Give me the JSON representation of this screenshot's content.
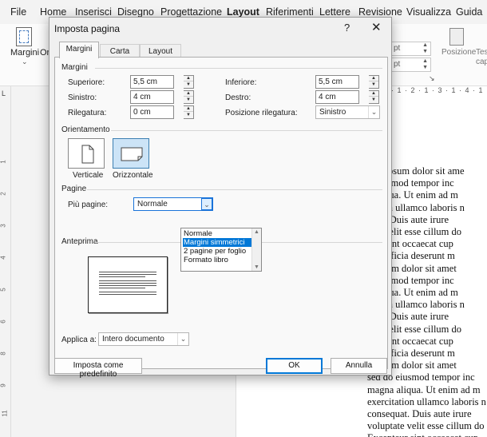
{
  "menubar": {
    "items": [
      "File",
      "Home",
      "Inserisci",
      "Disegno",
      "Progettazione",
      "Layout",
      "Riferimenti",
      "Lettere",
      "Revisione",
      "Visualizza",
      "Guida"
    ],
    "active": "Layout"
  },
  "ribbon": {
    "margini_label": "Margini",
    "or_label": "Or",
    "spin1": "pt",
    "spin2": "pt",
    "posizione_label": "Posizione",
    "tes_label": "Tes",
    "cap_label": "cap"
  },
  "ruler": {
    "top": "· 1 · 2 · 1 · 3 · 1 · 4 · 1 · 5",
    "corner": "L"
  },
  "document": {
    "lines": [
      "rem ipsum dolor sit ame",
      "o eiusmod tempor inc",
      "a aliqua. Ut enim ad m",
      "itation ullamco laboris n",
      "quat. Duis aute irure",
      "tate velit esse cillum do",
      "teur sint occaecat cup",
      " qui officia deserunt m",
      "n ipsum dolor sit amet",
      "o eiusmod tempor inc",
      "a aliqua. Ut enim ad m",
      "itation ullamco laboris n",
      "quat. Duis aute irure",
      "tate velit esse cillum do",
      "teur sint occaecat cup",
      " qui officia deserunt m",
      "n ipsum dolor sit amet",
      "sed do eiusmod tempor inc",
      "magna aliqua. Ut enim ad m",
      "exercitation ullamco laboris n",
      "consequat. Duis aute irure",
      "voluptate velit esse cillum do",
      "Excepteur sint occaecat cup"
    ]
  },
  "dialog": {
    "title": "Imposta pagina",
    "help": "?",
    "close": "✕",
    "tabs": [
      "Margini",
      "Carta",
      "Layout"
    ],
    "active_tab": "Margini",
    "margini": {
      "section": "Margini",
      "superiore_label": "Superiore:",
      "superiore_value": "5,5 cm",
      "inferiore_label": "Inferiore:",
      "inferiore_value": "5,5 cm",
      "sinistro_label": "Sinistro:",
      "sinistro_value": "4 cm",
      "destro_label": "Destro:",
      "destro_value": "4 cm",
      "rilegatura_label": "Rilegatura:",
      "rilegatura_value": "0 cm",
      "posizione_label": "Posizione rilegatura:",
      "posizione_value": "Sinistro"
    },
    "orientamento": {
      "section": "Orientamento",
      "verticale": "Verticale",
      "orizzontale": "Orizzontale",
      "selected": "Orizzontale"
    },
    "pagine": {
      "section": "Pagine",
      "piu_pagine_label": "Più pagine:",
      "value": "Normale",
      "options": [
        "Normale",
        "Margini simmetrici",
        "2 pagine per foglio",
        "Formato libro"
      ],
      "highlighted": "Margini simmetrici"
    },
    "anteprima": {
      "section": "Anteprima"
    },
    "applica": {
      "label": "Applica a:",
      "value": "Intero documento"
    },
    "buttons": {
      "predefinito": "Imposta come predefinito",
      "ok": "OK",
      "annulla": "Annulla"
    }
  }
}
